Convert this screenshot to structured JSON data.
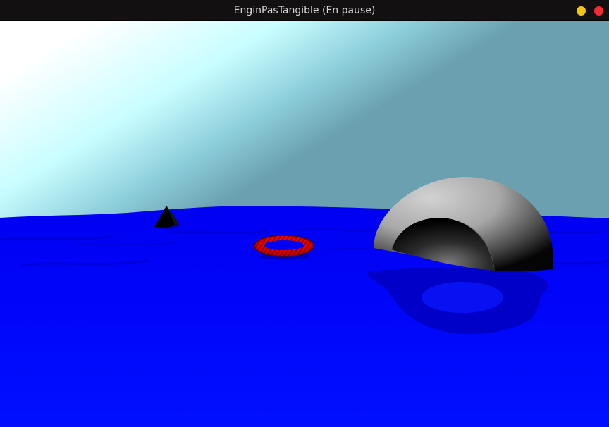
{
  "window": {
    "title": "EnginPasTangible (En pause)",
    "controls": {
      "minimize_color": "#f3c613",
      "close_color": "#ef2b36"
    }
  },
  "scene": {
    "sky_colors": [
      "#ffffff",
      "#c8fdff",
      "#8ecfdc",
      "#6aa0b0"
    ],
    "water_color": "#0000f8",
    "objects": [
      {
        "name": "black-pyramid",
        "color": "#000000"
      },
      {
        "name": "red-torus",
        "color": "#e80000"
      },
      {
        "name": "grey-half-dome",
        "color": "#9c9c9c"
      }
    ]
  }
}
